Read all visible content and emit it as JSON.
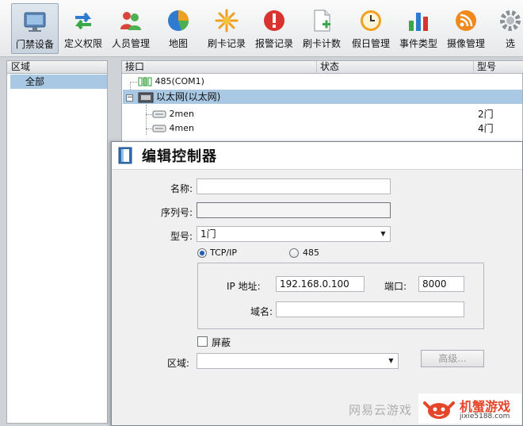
{
  "toolbar": {
    "items": [
      {
        "label": "门禁设备",
        "icon": "door-access-device-icon",
        "active": true
      },
      {
        "label": "定义权限",
        "icon": "permission-arrows-icon"
      },
      {
        "label": "人员管理",
        "icon": "people-icon"
      },
      {
        "label": "地图",
        "icon": "map-pie-icon"
      },
      {
        "label": "刷卡记录",
        "icon": "card-record-star-icon"
      },
      {
        "label": "报警记录",
        "icon": "alarm-exclamation-icon"
      },
      {
        "label": "刷卡计数",
        "icon": "card-count-doc-icon"
      },
      {
        "label": "假日管理",
        "icon": "holiday-clock-icon"
      },
      {
        "label": "事件类型",
        "icon": "event-bars-icon"
      },
      {
        "label": "摄像管理",
        "icon": "camera-rss-icon"
      },
      {
        "label": "选",
        "icon": "options-gear-icon"
      }
    ]
  },
  "areas": {
    "header": "区域",
    "items": [
      "全部"
    ]
  },
  "controllers": {
    "columns": {
      "port": "接口",
      "status": "状态",
      "model": "型号"
    },
    "rows": [
      {
        "name": "485(COM1)",
        "model": "",
        "icon": "serial-port-icon"
      },
      {
        "name": "以太网(以太网)",
        "model": "",
        "icon": "ethernet-icon",
        "selected": true,
        "expander": "−"
      },
      {
        "name": "2men",
        "model": "2门",
        "icon": "controller-device-icon"
      },
      {
        "name": "4men",
        "model": "4门",
        "icon": "controller-device-icon"
      }
    ]
  },
  "dialog": {
    "title": "编辑控制器",
    "name_label": "名称:",
    "name_value": "",
    "serial_label": "序列号:",
    "serial_value": "",
    "model_label": "型号:",
    "model_value": "1门",
    "radio_tcp": "TCP/IP",
    "radio_485": "485",
    "ip_label": "IP 地址:",
    "ip_value": "192.168.0.100",
    "port_label": "端口:",
    "port_value": "8000",
    "domain_label": "域名:",
    "domain_value": "",
    "block_label": "屏蔽",
    "area_label": "区域:",
    "area_value": "",
    "advanced_button": "高级..."
  },
  "watermark": {
    "overlay_text": "网易云游戏",
    "brand": "机蟹游戏",
    "url": "jixie5188.com"
  },
  "colors": {
    "selection": "#a9c8e3",
    "radio_dot": "#1f5fb7",
    "brand_red": "#e4462a"
  }
}
